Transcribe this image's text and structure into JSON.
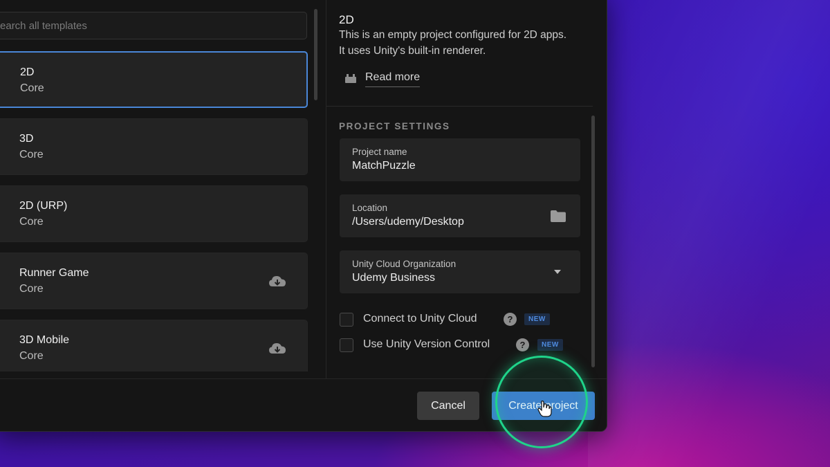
{
  "search": {
    "placeholder": "Search all templates"
  },
  "templates": [
    {
      "name": "2D",
      "category": "Core",
      "selected": true,
      "icon": "2d-template-icon",
      "downloadable": false
    },
    {
      "name": "3D",
      "category": "Core",
      "selected": false,
      "icon": "cube-icon",
      "downloadable": false
    },
    {
      "name": "2D (URP)",
      "category": "Core",
      "selected": false,
      "icon": "2d-urp-icon",
      "downloadable": false
    },
    {
      "name": "Runner Game",
      "category": "Core",
      "selected": false,
      "icon": "runner-game-icon",
      "downloadable": true
    },
    {
      "name": "3D Mobile",
      "category": "Core",
      "selected": false,
      "icon": "mobile-icon",
      "downloadable": true
    }
  ],
  "details": {
    "title": "2D",
    "description": "This is an empty project configured for 2D apps. It uses Unity's built-in renderer.",
    "read_more": "Read more"
  },
  "project_settings": {
    "heading": "PROJECT SETTINGS",
    "name_label": "Project name",
    "name_value": "MatchPuzzle",
    "location_label": "Location",
    "location_value": "/Users/udemy/Desktop",
    "org_label": "Unity Cloud Organization",
    "org_value": "Udemy Business",
    "connect_cloud_label": "Connect to Unity Cloud",
    "connect_cloud_checked": false,
    "connect_cloud_badge": "NEW",
    "version_control_label": "Use Unity Version Control",
    "version_control_checked": false,
    "version_control_badge": "NEW"
  },
  "footer": {
    "cancel_label": "Cancel",
    "create_label": "Create project"
  },
  "colors": {
    "accent": "#3f7ad0",
    "selection_border": "#4a87d8",
    "click_highlight": "#1fd48a",
    "badge_text": "#4f8be0"
  }
}
